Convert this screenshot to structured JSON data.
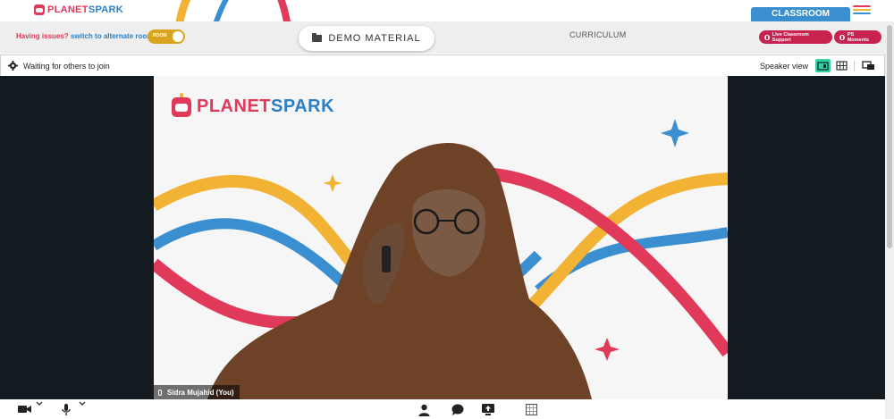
{
  "header": {
    "brand": {
      "part1": "PLANET",
      "part2": "SPARK"
    },
    "classroom_tab": "CLASSROOM",
    "menu_icon": "hamburger-icon"
  },
  "toolbar": {
    "issues_question": "Having issues?",
    "issues_action": "switch to alternate room",
    "room_toggle_label": "ROOM",
    "demo_material": "DEMO MATERIAL",
    "curriculum": "CURRICULUM",
    "live_support": "Live Classroom Support",
    "ps_moments": "PS Moments"
  },
  "meeting": {
    "status": "Waiting for others to join",
    "view_label": "Speaker view",
    "icons": [
      "gear-icon",
      "speaker-view-icon",
      "gallery-view-icon",
      "popout-icon"
    ]
  },
  "video": {
    "brand": {
      "part1": "PLANET",
      "part2": "SPARK"
    },
    "participant_name": "Sidra Mujahid (You)"
  },
  "controls": {
    "icons": [
      "camera-icon",
      "microphone-icon",
      "participants-icon",
      "chat-icon",
      "share-screen-icon",
      "whiteboard-icon"
    ]
  },
  "colors": {
    "brand_pink": "#e0395a",
    "brand_blue": "#2b7fc3",
    "brand_yellow": "#f2b233",
    "classroom_blue": "#3a8fd0",
    "support_red": "#c8234f",
    "speaker_view_active": "#33d1a0",
    "stage_dark": "#141b20"
  }
}
